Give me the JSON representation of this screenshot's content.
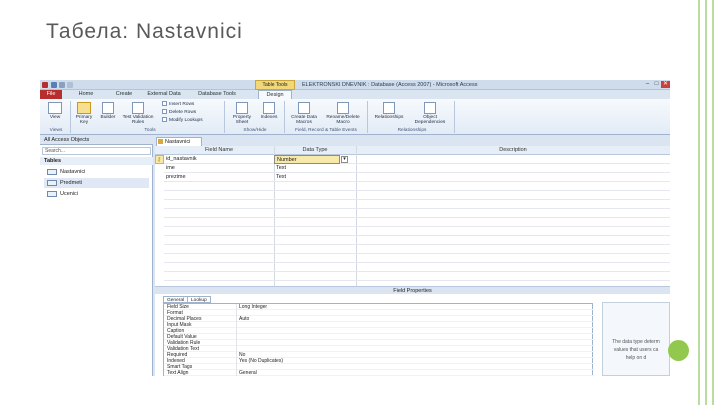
{
  "slide": {
    "title": "Табела: Nastavnici"
  },
  "window": {
    "contextual_tab": "Table Tools",
    "title": "ELEKTRONSKI DNEVNIK : Database (Access 2007) - Microsoft Access",
    "minimize": "–",
    "maximize": "□",
    "close": "✕"
  },
  "ribbon": {
    "tabs": [
      {
        "label": "File"
      },
      {
        "label": "Home"
      },
      {
        "label": "Create"
      },
      {
        "label": "External Data"
      },
      {
        "label": "Database Tools"
      },
      {
        "label": "Design"
      }
    ],
    "view_label": "View",
    "primary_key_label": "Primary Key",
    "builder_label": "Builder",
    "test_validation_label": "Test Validation Rules",
    "insert_rows": "Insert Rows",
    "delete_rows": "Delete Rows",
    "modify_lookups": "Modify Lookups",
    "property_sheet": "Property Sheet",
    "indexes": "Indexes",
    "create_data_macros": "Create Data Macros",
    "rename_delete_macro": "Rename/Delete Macro",
    "relationships": "Relationships",
    "object_dependencies": "Object Dependencies",
    "groups": {
      "views": "Views",
      "tools": "Tools",
      "show_hide": "Show/Hide",
      "field_events": "Field, Record & Table Events",
      "relationships": "Relationships"
    }
  },
  "nav": {
    "header": "All Access Objects",
    "search_placeholder": "Search...",
    "group": "Tables",
    "items": [
      {
        "label": "Nastavnici"
      },
      {
        "label": "Predmeti"
      },
      {
        "label": "Ucenici"
      }
    ]
  },
  "object_tab": "Nastavnici",
  "design_grid": {
    "headers": {
      "field_name": "Field Name",
      "data_type": "Data Type",
      "description": "Description"
    },
    "rows": [
      {
        "field_name": "id_nastavnik",
        "data_type": "Number"
      },
      {
        "field_name": "ime",
        "data_type": "Text"
      },
      {
        "field_name": "prezime",
        "data_type": "Text"
      }
    ]
  },
  "field_properties": {
    "bar_label": "Field Properties",
    "tabs": [
      "General",
      "Lookup"
    ],
    "rows": [
      {
        "name": "Field Size",
        "value": "Long Integer"
      },
      {
        "name": "Format",
        "value": ""
      },
      {
        "name": "Decimal Places",
        "value": "Auto"
      },
      {
        "name": "Input Mask",
        "value": ""
      },
      {
        "name": "Caption",
        "value": ""
      },
      {
        "name": "Default Value",
        "value": ""
      },
      {
        "name": "Validation Rule",
        "value": ""
      },
      {
        "name": "Validation Text",
        "value": ""
      },
      {
        "name": "Required",
        "value": "No"
      },
      {
        "name": "Indexed",
        "value": "Yes (No Duplicates)"
      },
      {
        "name": "Smart Tags",
        "value": ""
      },
      {
        "name": "Text Align",
        "value": "General"
      }
    ],
    "help_line1": "The data type determ",
    "help_line2": "values that users ca",
    "help_line3": "help on d"
  },
  "colors": {
    "accent_green": "#93c84f",
    "deco_lines": "#b9dca1",
    "file_tab": "#b72e2e",
    "contextual_tab": "#f1d778"
  }
}
